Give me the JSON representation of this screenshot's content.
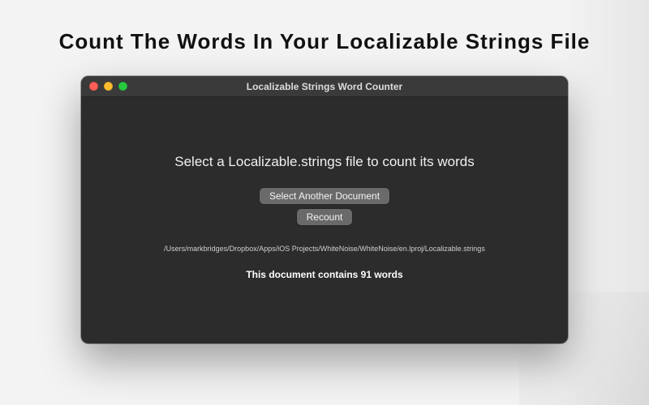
{
  "page": {
    "heading": "Count The Words In Your Localizable Strings File"
  },
  "window": {
    "title": "Localizable Strings Word Counter",
    "headline": "Select a Localizable.strings file to count its words",
    "select_button_label": "Select Another Document",
    "recount_button_label": "Recount",
    "file_path": "/Users/markbridges/Dropbox/Apps/iOS Projects/WhiteNoise/WhiteNoise/en.lproj/Localizable.strings",
    "result_text": "This document contains 91 words",
    "word_count": 91
  },
  "colors": {
    "window_bg": "#2c2c2c",
    "titlebar_bg": "#3a3a3a",
    "button_bg": "#6a6a6a",
    "traffic_close": "#ff5f57",
    "traffic_min": "#febc2e",
    "traffic_zoom": "#28c840"
  }
}
